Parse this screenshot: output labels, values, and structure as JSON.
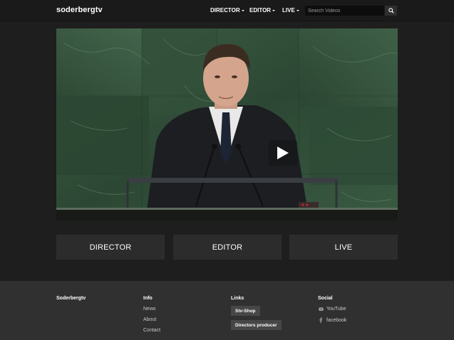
{
  "header": {
    "logo": "soderbergtv",
    "nav": [
      {
        "label": "DIRECTOR"
      },
      {
        "label": "EDITOR"
      },
      {
        "label": "LIVE"
      }
    ],
    "search_placeholder": "Search Videos",
    "search_icon": "magnifier"
  },
  "video": {
    "play_icon": "play-triangle"
  },
  "categories": [
    {
      "label": "DIRECTOR"
    },
    {
      "label": "EDITOR"
    },
    {
      "label": "LIVE"
    }
  ],
  "footer": {
    "brand": "Soderbergtv",
    "info": {
      "heading": "Info",
      "links": [
        "News",
        "About",
        "Contact"
      ]
    },
    "links": {
      "heading": "Links",
      "tags": [
        "Stv-Shop",
        "Directors producer"
      ]
    },
    "social": {
      "heading": "Social",
      "items": [
        {
          "label": "YouTube",
          "icon": "youtube"
        },
        {
          "label": "facebook",
          "icon": "facebook"
        }
      ]
    }
  },
  "colors": {
    "background": "#1e1e1e",
    "header": "#1a1a1a",
    "button": "#2c2c2c",
    "footer": "#303030",
    "tag": "#474747",
    "marble": "#2f4a37"
  }
}
